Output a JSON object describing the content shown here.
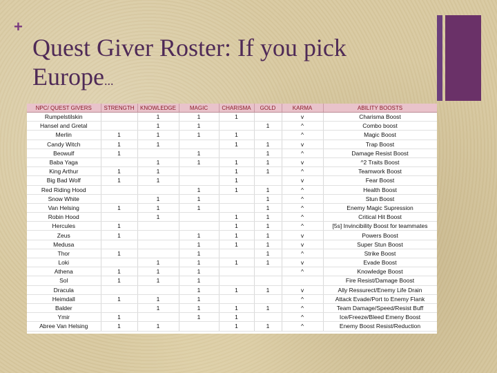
{
  "slide": {
    "plus": "+",
    "title": "Quest Giver  Roster: If you pick Europe",
    "title_suffix": "..."
  },
  "table": {
    "headers": [
      "NPC/ QUEST GIVERS",
      "STRENGTH",
      "KNOWLEDGE",
      "MAGIC",
      "CHARISMA",
      "GOLD",
      "KARMA",
      "ABILITY BOOSTS"
    ],
    "rows": [
      [
        "Rumpelstilskin",
        "",
        "1",
        "1",
        "1",
        "",
        "v",
        "Charisma Boost"
      ],
      [
        "Hansel and Gretal",
        "",
        "1",
        "1",
        "",
        "1",
        "^",
        "Combo boost"
      ],
      [
        "Merlin",
        "1",
        "1",
        "1",
        "1",
        "",
        "^",
        "Magic Boost"
      ],
      [
        "Candy Witch",
        "1",
        "1",
        "",
        "1",
        "1",
        "v",
        "Trap Boost"
      ],
      [
        "Beowulf",
        "1",
        "",
        "1",
        "",
        "1",
        "^",
        "Damage Resist Boost"
      ],
      [
        "Baba Yaga",
        "",
        "1",
        "1",
        "1",
        "1",
        "v",
        "^2 Traits Boost"
      ],
      [
        "King Arthur",
        "1",
        "1",
        "",
        "1",
        "1",
        "^",
        "Teamwork Boost"
      ],
      [
        "Big Bad Wolf",
        "1",
        "1",
        "",
        "1",
        "",
        "v",
        "Fear Boost"
      ],
      [
        "Red Riding Hood",
        "",
        "",
        "1",
        "1",
        "1",
        "^",
        "Health Boost"
      ],
      [
        "Snow White",
        "",
        "1",
        "1",
        "",
        "1",
        "^",
        "Stun Boost"
      ],
      [
        "Van Helsing",
        "1",
        "1",
        "1",
        "",
        "1",
        "^",
        "Enemy Magic Supression"
      ],
      [
        "Robin Hood",
        "",
        "1",
        "",
        "1",
        "1",
        "^",
        "Critical Hit Boost"
      ],
      [
        "Hercules",
        "1",
        "",
        "",
        "1",
        "1",
        "^",
        "[5s] Invincibility Boost for teammates"
      ],
      [
        "Zeus",
        "1",
        "",
        "1",
        "1",
        "1",
        "v",
        "Powers Boost"
      ],
      [
        "Medusa",
        "",
        "",
        "1",
        "1",
        "1",
        "v",
        "Super Stun Boost"
      ],
      [
        "Thor",
        "1",
        "",
        "1",
        "",
        "1",
        "^",
        "Strike Boost"
      ],
      [
        "Loki",
        "",
        "1",
        "1",
        "1",
        "1",
        "v",
        "Evade Boost"
      ],
      [
        "Athena",
        "1",
        "1",
        "1",
        "",
        "",
        "^",
        "Knowledge Boost"
      ],
      [
        "Sol",
        "1",
        "1",
        "1",
        "",
        "",
        "",
        "Fire Resist/Damage Boost"
      ],
      [
        "Dracula",
        "",
        "",
        "1",
        "1",
        "1",
        "v",
        "Ally Ressurect/Enemy Life Drain"
      ],
      [
        "Heimdall",
        "1",
        "1",
        "1",
        "",
        "",
        "^",
        "Attack Evade/Port to Enemy Flank"
      ],
      [
        "Balder",
        "",
        "1",
        "1",
        "1",
        "1",
        "^",
        "Team Damage/Speed/Resist Buff"
      ],
      [
        "Ymir",
        "1",
        "",
        "1",
        "1",
        "",
        "^",
        "Ice/Freeze/Bleed Emeny Boost"
      ],
      [
        "Abree Van Helsing",
        "1",
        "1",
        "",
        "1",
        "1",
        "^",
        "Enemy Boost Resist/Reduction"
      ]
    ]
  },
  "colors": {
    "title": "#4f2a57",
    "accent_bar": "#6a3168",
    "header_bg": "#e9c3cb",
    "header_text": "#8a1b2a"
  }
}
